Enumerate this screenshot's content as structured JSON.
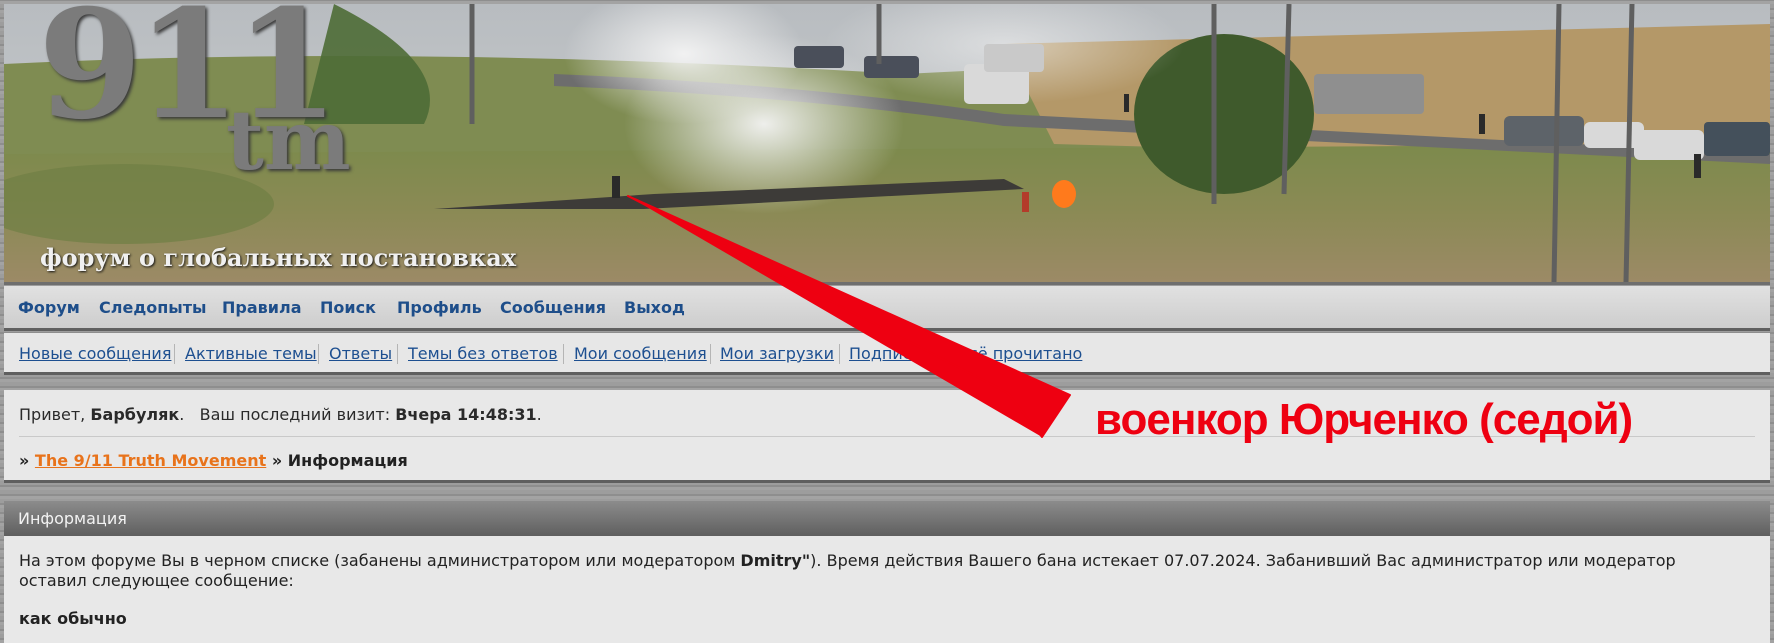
{
  "banner": {
    "logo_number": "911",
    "logo_suffix": "tm",
    "tagline": "форум о глобальных постановках"
  },
  "nav_main": {
    "items": [
      "Форум",
      "Следопыты",
      "Правила",
      "Поиск",
      "Профиль",
      "Сообщения",
      "Выход"
    ]
  },
  "nav_sub": {
    "items": [
      "Новые сообщения",
      "Активные темы",
      "Ответы",
      "Темы без ответов",
      "Мои сообщения",
      "Мои загрузки",
      "Подписка",
      "Всё прочитано"
    ]
  },
  "greeting": {
    "prefix": "Привет,",
    "username": "Барбуляк",
    "last_visit_label": "Ваш последний визит:",
    "last_visit_value": "Вчера 14:48:31"
  },
  "breadcrumb": {
    "sep": "»",
    "link": "The 9/11 Truth Movement",
    "current": "Информация"
  },
  "info": {
    "heading": "Информация",
    "message_before": "На этом форуме Вы в черном списке (забанены администратором или модератором ",
    "moderator": "Dmitry\"",
    "message_after": "). Время действия Вашего бана истекает 07.07.2024. Забанивший Вас администратор или модератор оставил следующее сообщение:",
    "ban_reason": "как обычно"
  },
  "annotation": {
    "caption": "военкор Юрченко (седой)",
    "color": "#ee0011"
  }
}
